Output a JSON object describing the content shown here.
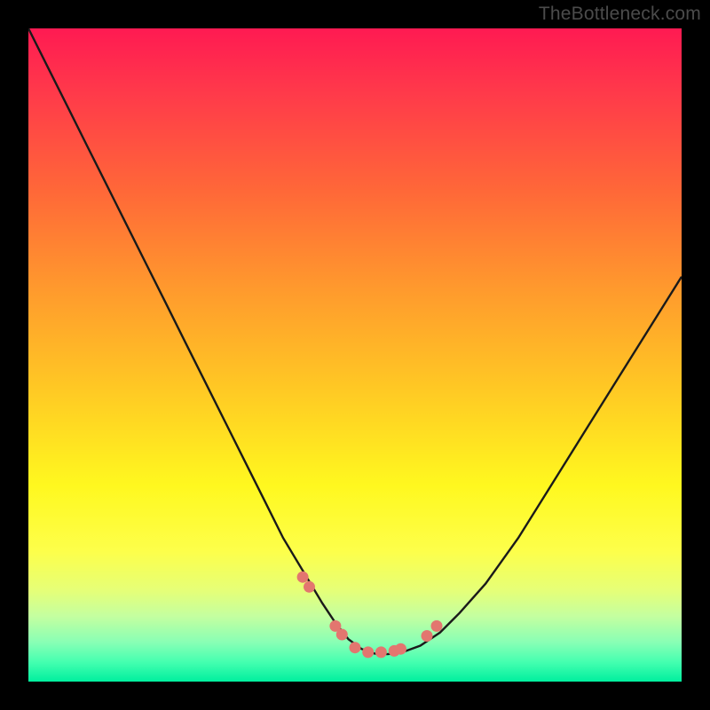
{
  "watermark": "TheBottleneck.com",
  "colors": {
    "frame": "#000000",
    "gradient_top": "#ff1a52",
    "gradient_mid1": "#ff9a2d",
    "gradient_mid2": "#fff81f",
    "gradient_bottom": "#00ef9e",
    "curve": "#1a1a1a",
    "markers": "#e3766f"
  },
  "chart_data": {
    "type": "line",
    "title": "",
    "xlabel": "",
    "ylabel": "",
    "xlim": [
      0,
      100
    ],
    "ylim": [
      0,
      100
    ],
    "grid": false,
    "legend": false,
    "x": [
      0,
      3,
      6,
      9,
      12,
      15,
      18,
      21,
      24,
      27,
      30,
      33,
      36,
      39,
      42,
      45,
      47,
      49,
      51,
      53,
      55,
      57,
      60,
      63,
      66,
      70,
      75,
      80,
      85,
      90,
      95,
      100
    ],
    "values": [
      100,
      94,
      88,
      82,
      76,
      70,
      64,
      58,
      52,
      46,
      40,
      34,
      28,
      22,
      17,
      12,
      9,
      6.5,
      5,
      4.3,
      4.2,
      4.4,
      5.5,
      7.5,
      10.5,
      15,
      22,
      30,
      38,
      46,
      54,
      62
    ],
    "markers": {
      "x": [
        42,
        43,
        47,
        48,
        50,
        52,
        54,
        56,
        57,
        61,
        62.5
      ],
      "values": [
        16,
        14.5,
        8.5,
        7.2,
        5.2,
        4.5,
        4.5,
        4.7,
        5,
        7,
        8.5
      ]
    },
    "annotations": []
  }
}
